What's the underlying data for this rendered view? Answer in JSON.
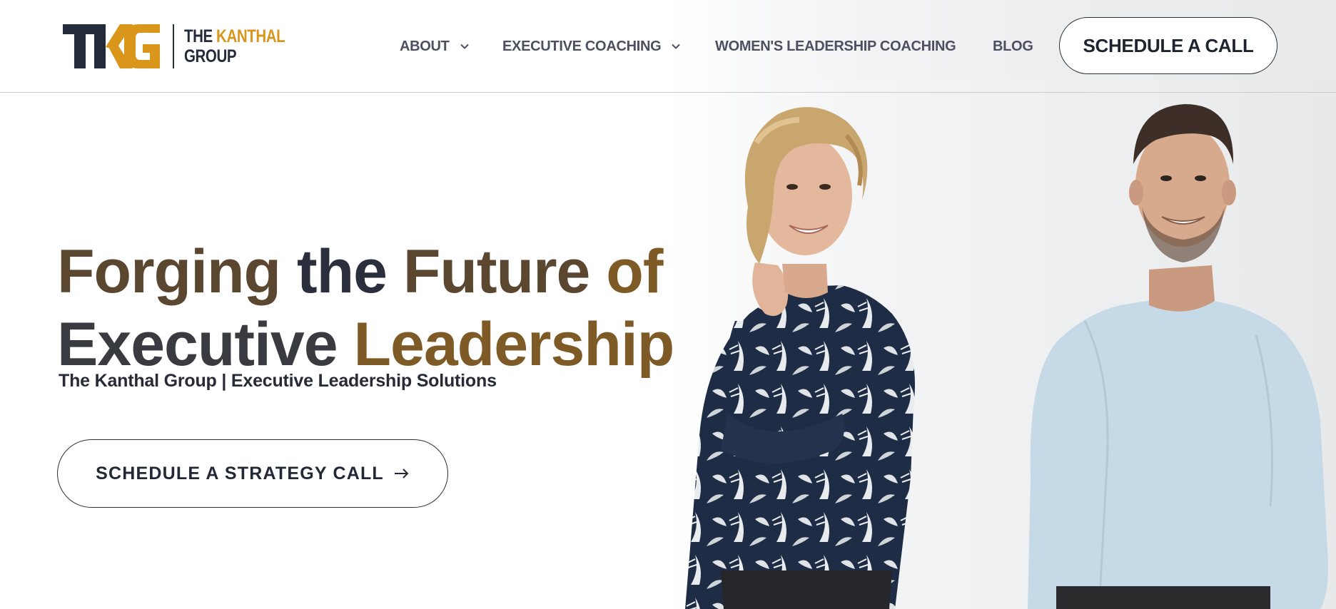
{
  "brand": {
    "mark_left": "TK",
    "mark_right": "G",
    "name_the": "THE",
    "name_kanthal": "KANTHAL",
    "name_group": "GROUP",
    "colors": {
      "navy": "#232a3a",
      "gold": "#d9961b"
    }
  },
  "nav": {
    "items": [
      {
        "label": "ABOUT",
        "has_dropdown": true
      },
      {
        "label": "EXECUTIVE COACHING",
        "has_dropdown": true
      },
      {
        "label": "WOMEN'S LEADERSHIP COACHING",
        "has_dropdown": false
      },
      {
        "label": "BLOG",
        "has_dropdown": false
      }
    ],
    "dropdown_icon": "chevron-down-icon",
    "cta_label": "SCHEDULE A CALL"
  },
  "hero": {
    "title_line1": {
      "w1": "Forging",
      "w2": "the",
      "w3": "Future",
      "w4": "of"
    },
    "title_line2": {
      "w1": "Executive",
      "w2": "Leadership"
    },
    "subtitle": "The Kanthal Group | Executive Leadership Solutions",
    "cta_label": "SCHEDULE A STRATEGY CALL",
    "cta_icon": "arrow-right-icon",
    "title_colors": [
      "#5b4630",
      "#2b2f3d",
      "#7e5b26",
      "#3a3b40"
    ]
  }
}
